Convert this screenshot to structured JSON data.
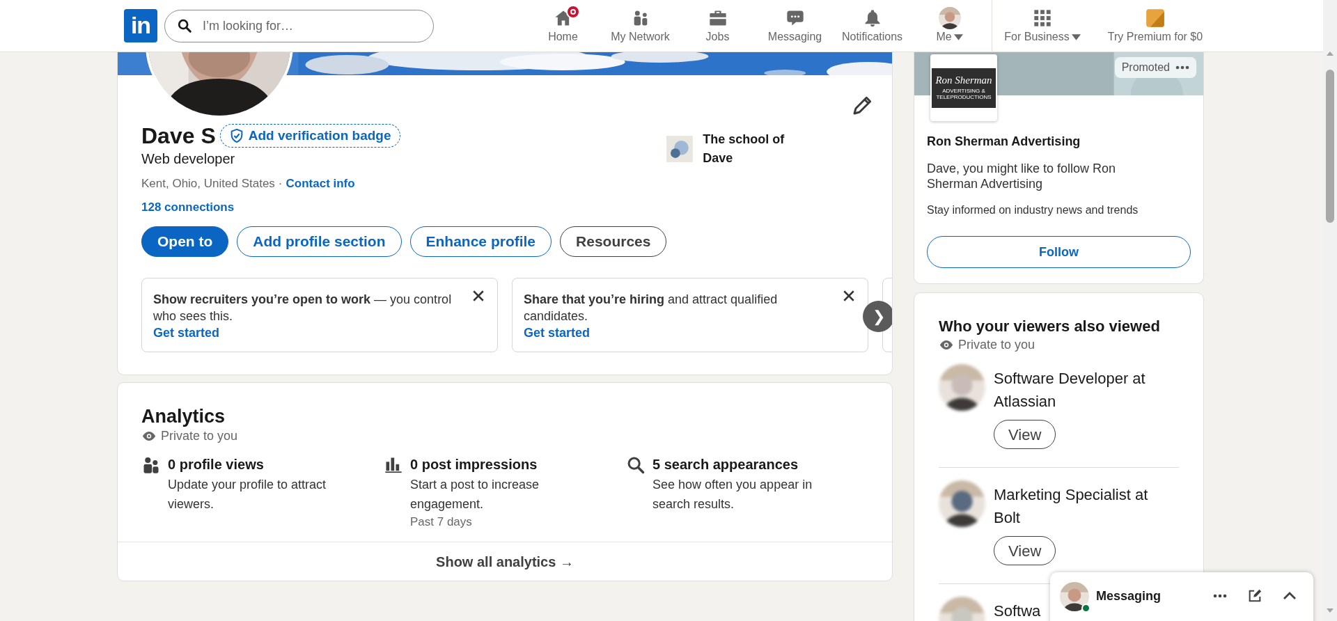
{
  "nav": {
    "logo": "in",
    "search": {
      "placeholder": "I’m looking for…"
    },
    "items": [
      {
        "kind": "home",
        "label": "Home",
        "notification_dot": true,
        "dropdown": false
      },
      {
        "kind": "network",
        "label": "My Network",
        "notification_dot": false,
        "dropdown": false
      },
      {
        "kind": "jobs",
        "label": "Jobs",
        "notification_dot": false,
        "dropdown": false
      },
      {
        "kind": "messaging",
        "label": "Messaging",
        "notification_dot": false,
        "dropdown": false
      },
      {
        "kind": "notifications",
        "label": "Notifications",
        "notification_dot": false,
        "dropdown": false
      },
      {
        "kind": "me",
        "label": "Me",
        "notification_dot": false,
        "dropdown": true
      }
    ],
    "business": [
      {
        "kind": "grid",
        "label": "For Business",
        "dropdown": true
      },
      {
        "kind": "premium",
        "label": "Try Premium for $0",
        "dropdown": false
      }
    ]
  },
  "profile": {
    "name": "Dave S",
    "verification": "Add verification badge",
    "headline": "Web developer",
    "location": "Kent, Ohio, United States",
    "separator": "·",
    "contact": "Contact info",
    "connections": "128 connections",
    "school": "The school of Dave",
    "buttons": [
      {
        "label": "Open to",
        "kind": "primary"
      },
      {
        "label": "Add profile section",
        "kind": "secondary"
      },
      {
        "label": "Enhance profile",
        "kind": "secondary"
      },
      {
        "label": "Resources",
        "kind": "tertiary"
      }
    ],
    "prompts": [
      {
        "text": "**Show recruiters you’re open to work** — you control who sees this.",
        "link": "Get started"
      },
      {
        "text": "**Share that you’re hiring** and attract qualified candidates.",
        "link": "Get started"
      }
    ],
    "next": "❯"
  },
  "analytics": {
    "title": "Analytics",
    "privacy": "Private to you",
    "items": [
      {
        "kind": "people",
        "title": "0 profile views",
        "description": "Update your profile to attract viewers."
      },
      {
        "kind": "bars",
        "title": "0 post impressions",
        "description": "Start a post to increase engagement.",
        "note": "Past 7 days"
      },
      {
        "kind": "search",
        "title": "5 search appearances",
        "description": "See how often you appear in search results."
      }
    ],
    "footer": "Show all analytics →"
  },
  "ad": {
    "promoted": "Promoted",
    "logo_lines": [
      "Ron Sherman",
      "ADVERTISING &",
      "TELEPRODUCTIONS"
    ],
    "company": "Ron Sherman Advertising",
    "message": "Dave, you might like to follow Ron Sherman Advertising",
    "tagline": "Stay informed on industry news and trends",
    "button": "Follow"
  },
  "viewers": {
    "title": "Who your viewers also viewed",
    "privacy": "Private to you",
    "people": [
      {
        "title": "Software Developer at Atlassian",
        "button": "View"
      },
      {
        "title": "Marketing Specialist at Bolt",
        "button": "View"
      },
      {
        "title": "Softwa"
      }
    ]
  },
  "messaging": {
    "label": "Messaging",
    "online": true
  }
}
